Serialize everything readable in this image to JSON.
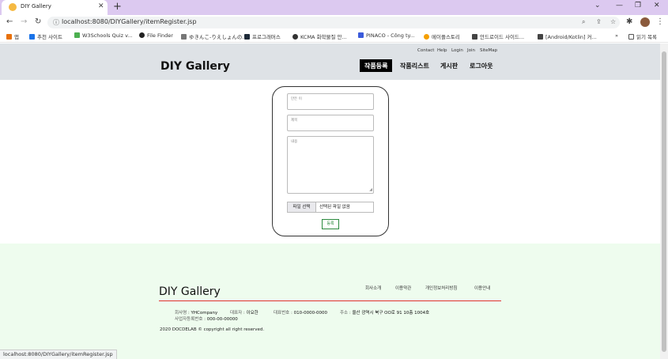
{
  "browser": {
    "tab_title": "DIY Gallery",
    "url": "localhost:8080/DIYGallery/itemRegister.jsp",
    "status_url": "localhost:8080/DIYGallery/itemRegister.jsp",
    "bookmarks": [
      "앱",
      "추천 사이트",
      "W3Schools Quiz v...",
      "File Finder",
      "ゆきんこ-りえしょんの...",
      "프로그래머스",
      "KCMA 화학물질 안...",
      "PINACO - Công ty...",
      "메이플스토리",
      "안드로이드 사이드...",
      "[Android/Kotlin] 커...",
      "읽기 목록"
    ],
    "bookmark_more": "»"
  },
  "header": {
    "utility_links": [
      "Contact",
      "Help",
      "Login",
      "Join",
      "SiteMap"
    ],
    "logo": "DIY Gallery",
    "menu": [
      "작품등록",
      "작품리스트",
      "게시판",
      "로그아웃"
    ],
    "active_menu": "작품등록"
  },
  "form": {
    "author_placeholder": "만든 이",
    "title_placeholder": "제목",
    "content_placeholder": "내용",
    "file_button": "파일 선택",
    "file_status": "선택된 파일 없음",
    "submit_label": "등록"
  },
  "footer": {
    "logo": "DIY Gallery",
    "links": [
      "회사소개",
      "이용약관",
      "개인정보처리방침",
      "이용안내"
    ],
    "company_label": "회사명 :",
    "company": "YHCompany",
    "ceo_label": "대표자 :",
    "ceo": "이요한",
    "phone_label": "대표번호 :",
    "phone": "010-0000-0000",
    "address_label": "주소 :",
    "address": "울산 광역시 북구 OO로 91 10층 1004호",
    "biz_label": "사업자등록번호 :",
    "biz": "000-00-00000",
    "copyright": "2020 DOCDELAB © copyright all right reserved."
  },
  "colors": {
    "header_bg": "#dee2e6",
    "footer_bg": "#eefcee",
    "footer_line": "#e03131",
    "submit_border": "#2b8a3e",
    "tabstrip": "#dcc9f0"
  }
}
